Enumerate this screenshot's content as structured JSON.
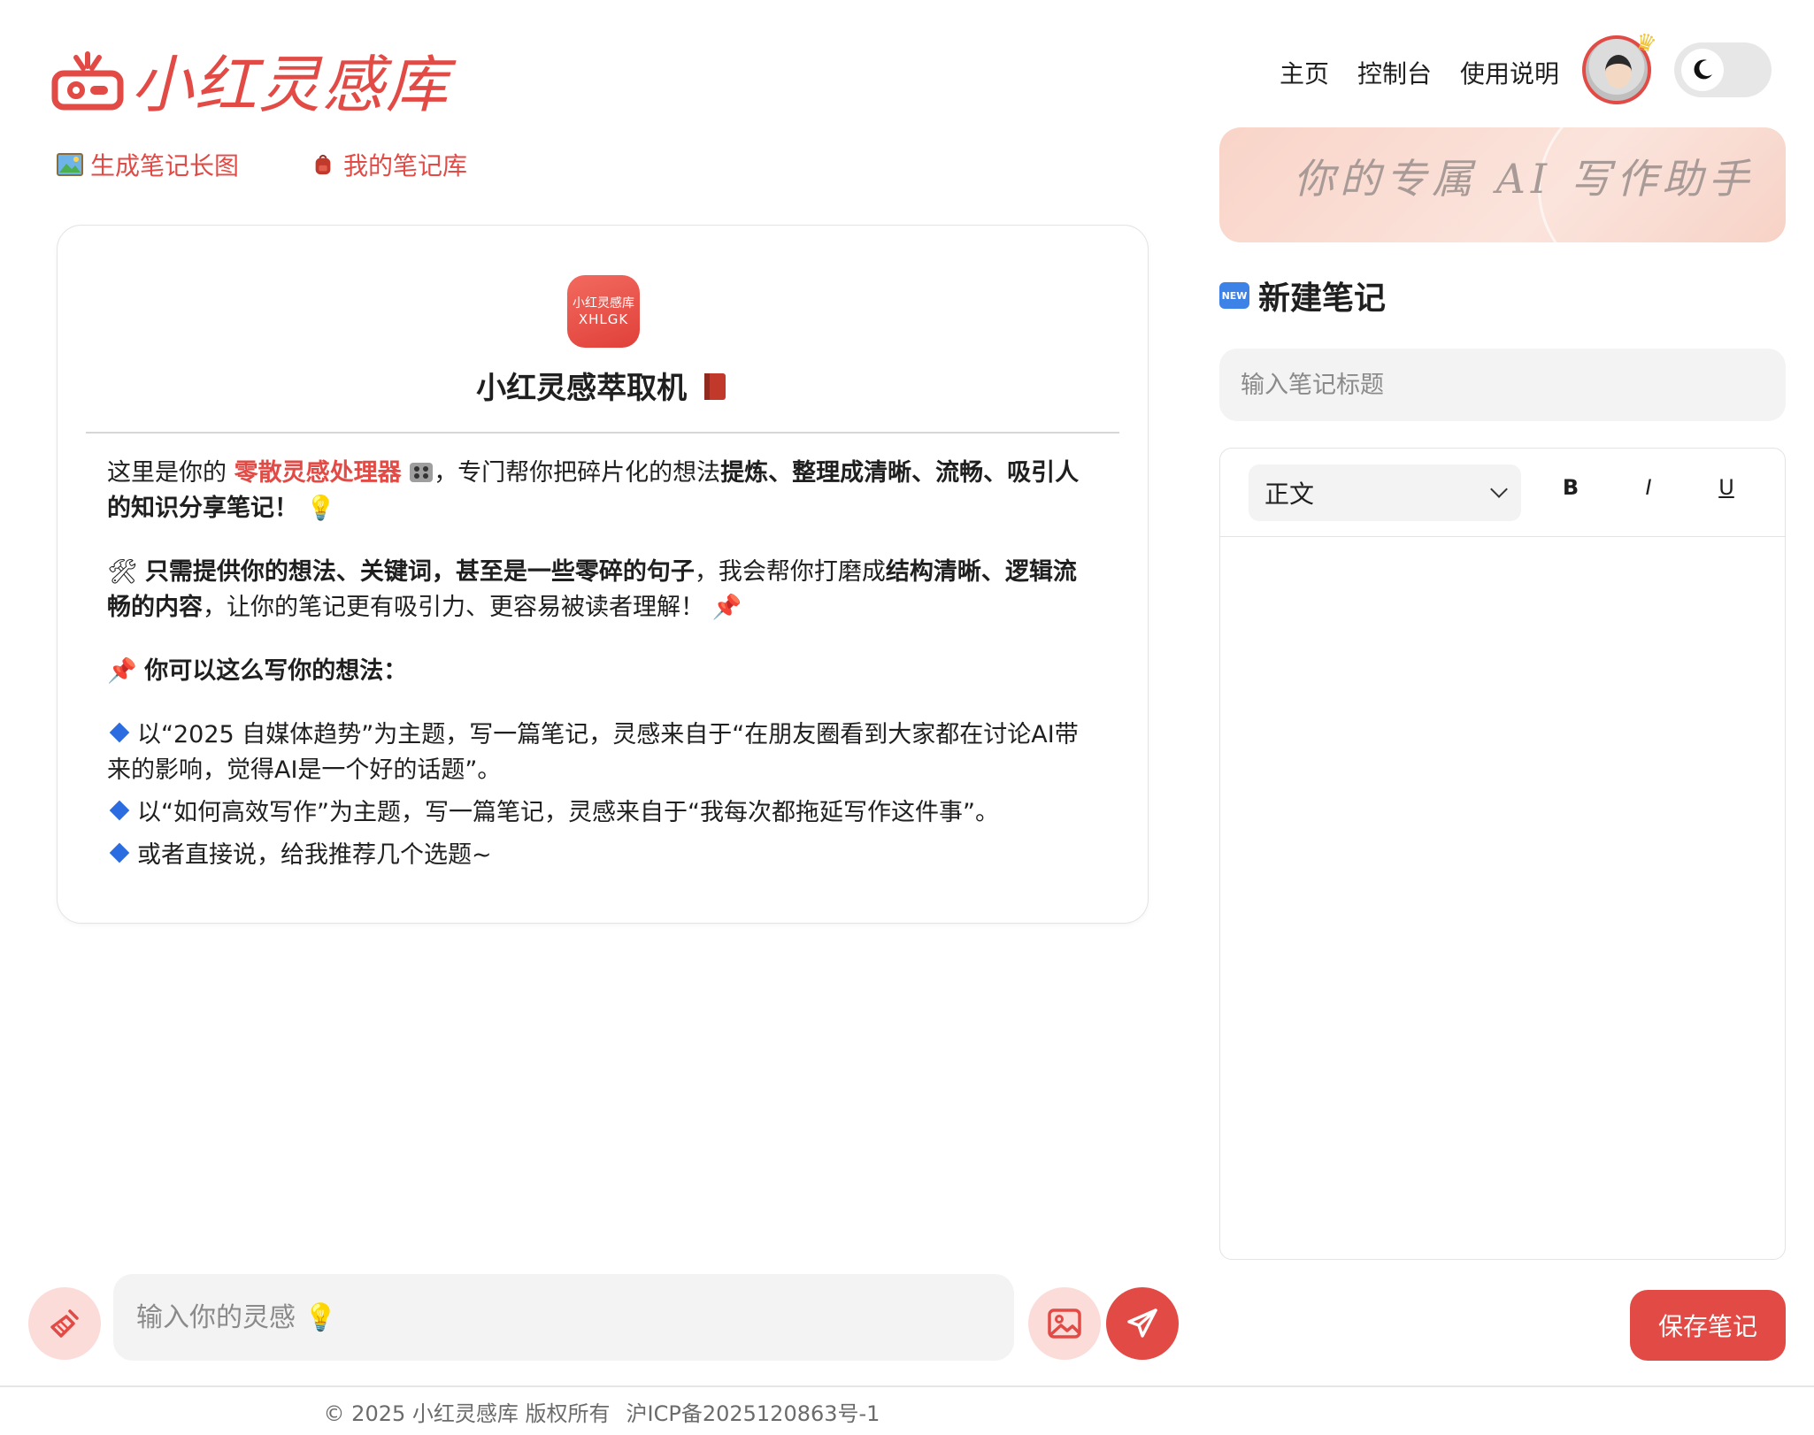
{
  "brand": {
    "name": "小红灵感库",
    "accent": "#e24a45"
  },
  "nav": {
    "items": [
      "主页",
      "控制台",
      "使用说明"
    ]
  },
  "theme_toggle": {
    "mode": "dark-moon-icon"
  },
  "sub_links": [
    {
      "label": "生成笔记长图",
      "icon": "picture-icon"
    },
    {
      "label": "我的笔记库",
      "icon": "backpack-icon"
    }
  ],
  "banner": {
    "text": "你的专属 AI 写作助手"
  },
  "card": {
    "app_icon": {
      "line1": "小红灵感库",
      "line2": "XHLGK"
    },
    "title": "小红灵感萃取机",
    "intro": {
      "a": "这里是你的 ",
      "highlight": "零散灵感处理器",
      "b": "，专门帮你把碎片化的想法",
      "c": "提炼、整理成清晰、流畅、吸引人的知识分享笔记",
      "d": "！"
    },
    "para2": {
      "a": "只需提供你的想法、关键词，甚至是一些零碎的句子",
      "b": "，我会帮你打磨成",
      "c": "结构清晰、逻辑流畅的内容",
      "d": "，让你的笔记更有吸引力、更容易被读者理解！"
    },
    "howto": "你可以这么写你的想法：",
    "examples": [
      "以“2025 自媒体趋势”为主题，写一篇笔记，灵感来自于“在朋友圈看到大家都在讨论AI带来的影响，觉得AI是一个好的话题”。",
      "以“如何高效写作”为主题，写一篇笔记，灵感来自于“我每次都拖延写作这件事”。",
      "或者直接说，给我推荐几个选题~"
    ]
  },
  "new_note": {
    "badge": "NEW",
    "title": "新建笔记",
    "title_placeholder": "输入笔记标题",
    "style_select": "正文",
    "format": {
      "bold": "B",
      "italic": "I",
      "underline": "U"
    },
    "save_label": "保存笔记"
  },
  "prompt": {
    "placeholder": "输入你的灵感 💡"
  },
  "footer": {
    "copyright": "© 2025 小红灵感库 版权所有",
    "icp": "沪ICP备2025120863号-1"
  }
}
